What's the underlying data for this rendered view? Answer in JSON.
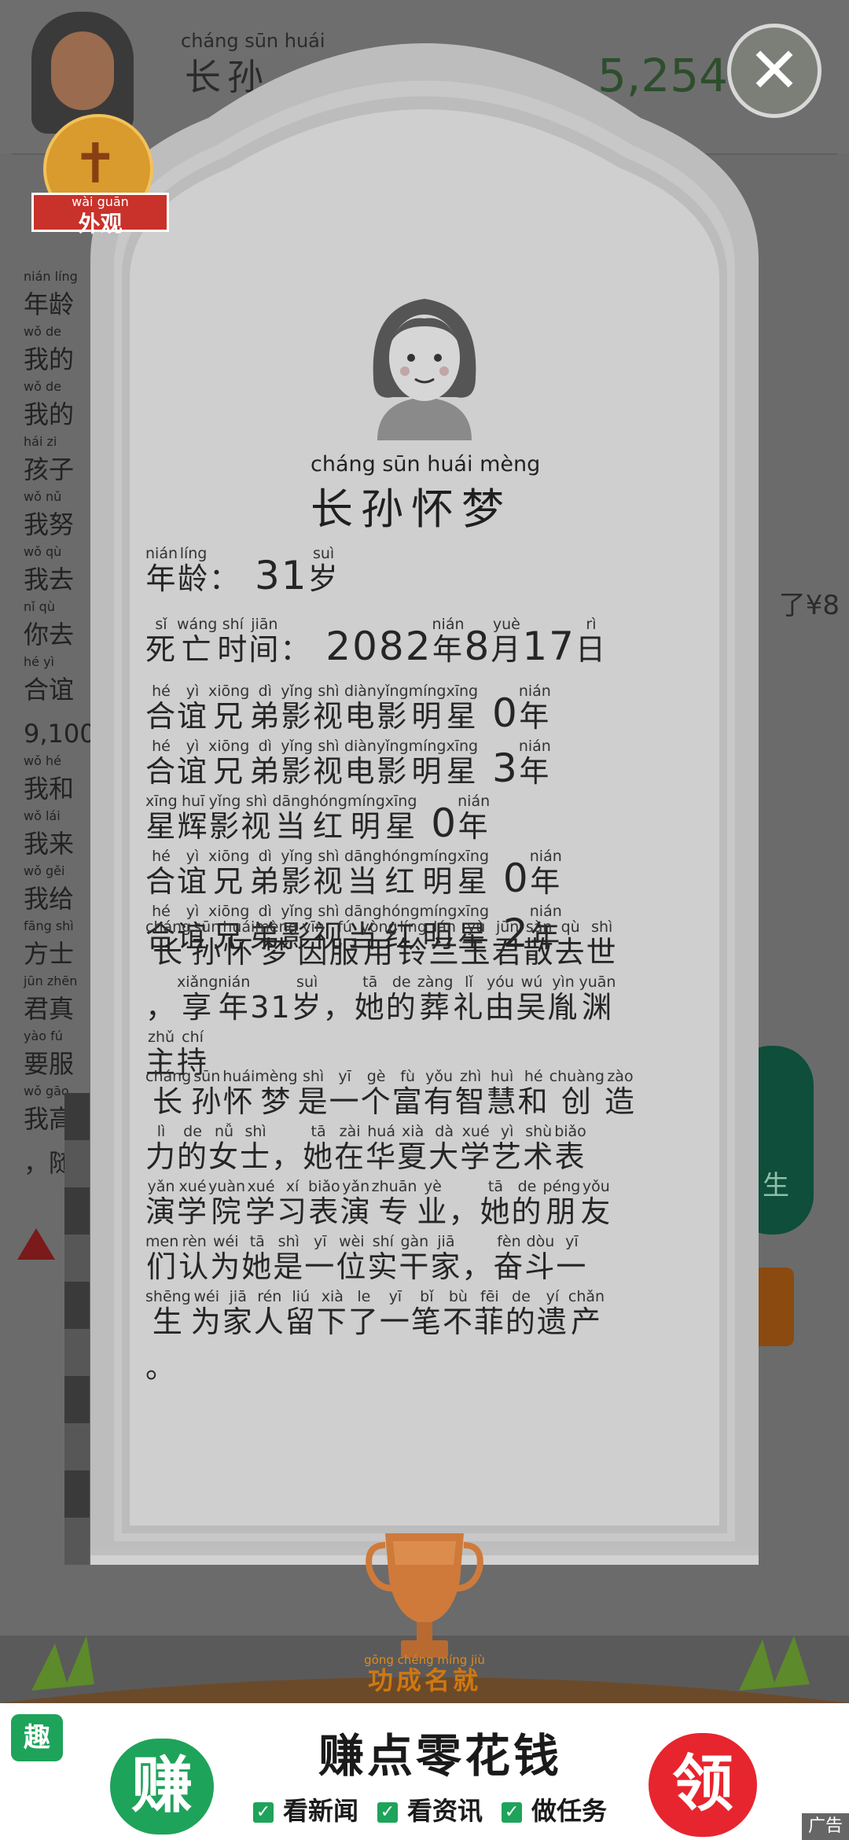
{
  "background": {
    "player_name_pinyin": "cháng sūn huái",
    "player_name": "长孙",
    "money": "5,254",
    "left_column": [
      {
        "py": "nián líng",
        "text": "年龄"
      },
      {
        "py": "wǒ de",
        "text": "我的"
      },
      {
        "py": "wǒ de",
        "text": "我的"
      },
      {
        "py": "hái zi",
        "text": "孩子"
      },
      {
        "py": "wǒ nǔ",
        "text": "我努"
      },
      {
        "py": "wǒ qù",
        "text": "我去"
      },
      {
        "py": "nǐ qù",
        "text": "你去"
      },
      {
        "py": "hé yì",
        "text": "合谊"
      },
      {
        "py": "",
        "text": "9,100"
      },
      {
        "py": "wǒ hé",
        "text": "我和"
      },
      {
        "py": "wǒ lái",
        "text": "我来"
      },
      {
        "py": "wǒ gěi",
        "text": "我给"
      },
      {
        "py": "fāng shì",
        "text": "方士"
      },
      {
        "py": "jūn zhēn",
        "text": "君真"
      },
      {
        "py": "yào fú",
        "text": "要服"
      },
      {
        "py": "wǒ gāo",
        "text": "我高"
      },
      {
        "py": "",
        "text": "，随"
      }
    ],
    "right_note": "了¥8",
    "right_pill_label": "生"
  },
  "close_label": "✕",
  "badge": {
    "pinyin": "wài guān",
    "label": "外观"
  },
  "tomb": {
    "name_pinyin": "cháng sūn huái mèng",
    "name": "长孙怀梦",
    "age": {
      "label": [
        [
          "年",
          "nián"
        ],
        [
          "龄",
          "líng"
        ]
      ],
      "colon": "：",
      "value": "31",
      "unit": [
        [
          "岁",
          "suì"
        ]
      ]
    },
    "death": {
      "label": [
        [
          "死",
          "sǐ"
        ],
        [
          "亡",
          "wáng"
        ],
        [
          "时",
          "shí"
        ],
        [
          "间",
          "jiān"
        ]
      ],
      "colon": "：",
      "year": "2082",
      "year_unit": [
        [
          "年",
          "nián"
        ]
      ],
      "month": "8",
      "month_unit": [
        [
          "月",
          "yuè"
        ]
      ],
      "day": "17",
      "day_unit": [
        [
          "日",
          "rì"
        ]
      ]
    },
    "records": [
      {
        "chars": [
          [
            "合",
            "hé"
          ],
          [
            "谊",
            "yì"
          ],
          [
            "兄",
            "xiōng"
          ],
          [
            "弟",
            "dì"
          ],
          [
            "影",
            "yǐng"
          ],
          [
            "视",
            "shì"
          ],
          [
            "电",
            "diàn"
          ],
          [
            "影",
            "yǐng"
          ],
          [
            "明",
            "míng"
          ],
          [
            "星",
            "xīng"
          ]
        ],
        "num": "0",
        "unit": [
          [
            "年",
            "nián"
          ]
        ]
      },
      {
        "chars": [
          [
            "合",
            "hé"
          ],
          [
            "谊",
            "yì"
          ],
          [
            "兄",
            "xiōng"
          ],
          [
            "弟",
            "dì"
          ],
          [
            "影",
            "yǐng"
          ],
          [
            "视",
            "shì"
          ],
          [
            "电",
            "diàn"
          ],
          [
            "影",
            "yǐng"
          ],
          [
            "明",
            "míng"
          ],
          [
            "星",
            "xīng"
          ]
        ],
        "num": "3",
        "unit": [
          [
            "年",
            "nián"
          ]
        ]
      },
      {
        "chars": [
          [
            "星",
            "xīng"
          ],
          [
            "辉",
            "huī"
          ],
          [
            "影",
            "yǐng"
          ],
          [
            "视",
            "shì"
          ],
          [
            "当",
            "dāng"
          ],
          [
            "红",
            "hóng"
          ],
          [
            "明",
            "míng"
          ],
          [
            "星",
            "xīng"
          ]
        ],
        "num": "0",
        "unit": [
          [
            "年",
            "nián"
          ]
        ]
      },
      {
        "chars": [
          [
            "合",
            "hé"
          ],
          [
            "谊",
            "yì"
          ],
          [
            "兄",
            "xiōng"
          ],
          [
            "弟",
            "dì"
          ],
          [
            "影",
            "yǐng"
          ],
          [
            "视",
            "shì"
          ],
          [
            "当",
            "dāng"
          ],
          [
            "红",
            "hóng"
          ],
          [
            "明",
            "míng"
          ],
          [
            "星",
            "xīng"
          ]
        ],
        "num": "0",
        "unit": [
          [
            "年",
            "nián"
          ]
        ]
      },
      {
        "chars": [
          [
            "合",
            "hé"
          ],
          [
            "谊",
            "yì"
          ],
          [
            "兄",
            "xiōng"
          ],
          [
            "弟",
            "dì"
          ],
          [
            "影",
            "yǐng"
          ],
          [
            "视",
            "shì"
          ],
          [
            "当",
            "dāng"
          ],
          [
            "红",
            "hóng"
          ],
          [
            "明",
            "míng"
          ],
          [
            "星",
            "xīng"
          ]
        ],
        "num": "2",
        "unit": [
          [
            "年",
            "nián"
          ]
        ]
      }
    ],
    "funeral_lines": [
      [
        [
          "长",
          "cháng"
        ],
        [
          "孙",
          "sūn"
        ],
        [
          "怀",
          "huái"
        ],
        [
          "梦",
          "mèng"
        ],
        [
          "因",
          "yīn"
        ],
        [
          "服",
          "fú"
        ],
        [
          "用",
          "yòng"
        ],
        [
          "铃",
          "líng"
        ],
        [
          "兰",
          "lán"
        ],
        [
          "玉",
          "yù"
        ],
        [
          "君",
          "jūn"
        ],
        [
          "散",
          "sàn"
        ],
        [
          "去",
          "qù"
        ],
        [
          "世",
          "shì"
        ]
      ],
      [
        [
          "，",
          ""
        ],
        [
          "享",
          "xiǎng"
        ],
        [
          "年",
          "nián"
        ],
        [
          "31",
          ""
        ],
        [
          "岁",
          "suì"
        ],
        [
          "，",
          ""
        ],
        [
          "她",
          "tā"
        ],
        [
          "的",
          "de"
        ],
        [
          "葬",
          "zàng"
        ],
        [
          "礼",
          "lǐ"
        ],
        [
          "由",
          "yóu"
        ],
        [
          "吴",
          "wú"
        ],
        [
          "胤",
          "yìn"
        ],
        [
          "渊",
          "yuān"
        ]
      ],
      [
        [
          "主",
          "zhǔ"
        ],
        [
          "持",
          "chí"
        ]
      ]
    ],
    "bio_lines": [
      [
        [
          "长",
          "cháng"
        ],
        [
          "孙",
          "sūn"
        ],
        [
          "怀",
          "huái"
        ],
        [
          "梦",
          "mèng"
        ],
        [
          "是",
          "shì"
        ],
        [
          "一",
          "yī"
        ],
        [
          "个",
          "gè"
        ],
        [
          "富",
          "fù"
        ],
        [
          "有",
          "yǒu"
        ],
        [
          "智",
          "zhì"
        ],
        [
          "慧",
          "huì"
        ],
        [
          "和",
          "hé"
        ],
        [
          "创",
          "chuàng"
        ],
        [
          "造",
          "zào"
        ]
      ],
      [
        [
          "力",
          "lì"
        ],
        [
          "的",
          "de"
        ],
        [
          "女",
          "nǚ"
        ],
        [
          "士",
          "shì"
        ],
        [
          "，",
          ""
        ],
        [
          "她",
          "tā"
        ],
        [
          "在",
          "zài"
        ],
        [
          "华",
          "huá"
        ],
        [
          "夏",
          "xià"
        ],
        [
          "大",
          "dà"
        ],
        [
          "学",
          "xué"
        ],
        [
          "艺",
          "yì"
        ],
        [
          "术",
          "shù"
        ],
        [
          "表",
          "biǎo"
        ]
      ],
      [
        [
          "演",
          "yǎn"
        ],
        [
          "学",
          "xué"
        ],
        [
          "院",
          "yuàn"
        ],
        [
          "学",
          "xué"
        ],
        [
          "习",
          "xí"
        ],
        [
          "表",
          "biǎo"
        ],
        [
          "演",
          "yǎn"
        ],
        [
          "专",
          "zhuān"
        ],
        [
          "业",
          "yè"
        ],
        [
          "，",
          ""
        ],
        [
          "她",
          "tā"
        ],
        [
          "的",
          "de"
        ],
        [
          "朋",
          "péng"
        ],
        [
          "友",
          "yǒu"
        ]
      ],
      [
        [
          "们",
          "men"
        ],
        [
          "认",
          "rèn"
        ],
        [
          "为",
          "wéi"
        ],
        [
          "她",
          "tā"
        ],
        [
          "是",
          "shì"
        ],
        [
          "一",
          "yī"
        ],
        [
          "位",
          "wèi"
        ],
        [
          "实",
          "shí"
        ],
        [
          "干",
          "gàn"
        ],
        [
          "家",
          "jiā"
        ],
        [
          "，",
          ""
        ],
        [
          "奋",
          "fèn"
        ],
        [
          "斗",
          "dòu"
        ],
        [
          "一",
          "yī"
        ]
      ],
      [
        [
          "生",
          "shēng"
        ],
        [
          "为",
          "wéi"
        ],
        [
          "家",
          "jiā"
        ],
        [
          "人",
          "rén"
        ],
        [
          "留",
          "liú"
        ],
        [
          "下",
          "xià"
        ],
        [
          "了",
          "le"
        ],
        [
          "一",
          "yī"
        ],
        [
          "笔",
          "bǐ"
        ],
        [
          "不",
          "bù"
        ],
        [
          "菲",
          "fēi"
        ],
        [
          "的",
          "de"
        ],
        [
          "遗",
          "yí"
        ],
        [
          "产",
          "chǎn"
        ]
      ],
      [
        [
          "。",
          ""
        ]
      ]
    ]
  },
  "trophy": {
    "pinyin": "gōng chéng míng jiù",
    "label": "功成名就"
  },
  "ad": {
    "corner_icon": "趣",
    "left_char": "赚",
    "right_char": "领",
    "title": "赚点零花钱",
    "features": [
      "看新闻",
      "看资讯",
      "做任务"
    ],
    "tag": "广告"
  },
  "colors": {
    "stone": "#c9c9c9",
    "stone_edge": "#b3b3b3",
    "ad_green": "#1ea35a",
    "ad_red": "#e7252e",
    "trophy": "#d07712"
  }
}
